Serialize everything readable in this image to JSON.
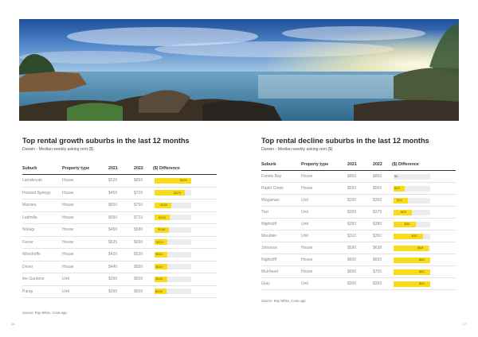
{
  "hero": {
    "alt_subject": "coastal sunset photo"
  },
  "left": {
    "title": "Top rental growth suburbs in the last 12 months",
    "subtitle": "Darwin - Median weekly asking rent ($)",
    "headers": [
      "Suburb",
      "Property type",
      "2021",
      "2022",
      "($) Difference"
    ],
    "rows": [
      {
        "suburb": "Larrakeyah",
        "type": "House",
        "y2021": "$525",
        "y2022": "$850",
        "diff": "$325",
        "diff_value": 325
      },
      {
        "suburb": "Howard Springs",
        "type": "House",
        "y2021": "$455",
        "y2022": "$725",
        "diff": "$270",
        "diff_value": 270
      },
      {
        "suburb": "Marrara",
        "type": "House",
        "y2021": "$600",
        "y2022": "$750",
        "diff": "$150",
        "diff_value": 150
      },
      {
        "suburb": "Ludmilla",
        "type": "House",
        "y2021": "$590",
        "y2022": "$723",
        "diff": "$133",
        "diff_value": 133
      },
      {
        "suburb": "Wulagi",
        "type": "House",
        "y2021": "$450",
        "y2022": "$580",
        "diff": "$130",
        "diff_value": 130
      },
      {
        "suburb": "Farrar",
        "type": "House",
        "y2021": "$535",
        "y2022": "$650",
        "diff": "$115",
        "diff_value": 115
      },
      {
        "suburb": "Woodroffe",
        "type": "House",
        "y2021": "$420",
        "y2022": "$530",
        "diff": "$110",
        "diff_value": 110
      },
      {
        "suburb": "Driver",
        "type": "House",
        "y2021": "$440",
        "y2022": "$550",
        "diff": "$110",
        "diff_value": 110
      },
      {
        "suburb": "the Gardens",
        "type": "Unit",
        "y2021": "$390",
        "y2022": "$500",
        "diff": "$110",
        "diff_value": 110
      },
      {
        "suburb": "Parap",
        "type": "Unit",
        "y2021": "$395",
        "y2022": "$500",
        "diff": "$105",
        "diff_value": 105
      }
    ],
    "bar_max": 325,
    "source": "Source: Ray White, CoreLogic"
  },
  "right": {
    "title": "Top rental decline suburbs in the last 12 months",
    "subtitle": "Darwin - Median weekly asking rent ($)",
    "headers": [
      "Suburb",
      "Property type",
      "2021",
      "2022",
      "($) Difference"
    ],
    "rows": [
      {
        "suburb": "Fannie Bay",
        "type": "House",
        "y2021": "$850",
        "y2022": "$850",
        "diff": "$0",
        "diff_value": 0
      },
      {
        "suburb": "Rapid Creek",
        "type": "House",
        "y2021": "$550",
        "y2022": "$565",
        "diff": "$15",
        "diff_value": 15
      },
      {
        "suburb": "Wagaman",
        "type": "Unit",
        "y2021": "$330",
        "y2022": "$350",
        "diff": "$20",
        "diff_value": 20
      },
      {
        "suburb": "Tiwi",
        "type": "Unit",
        "y2021": "$350",
        "y2022": "$375",
        "diff": "$25",
        "diff_value": 25
      },
      {
        "suburb": "Nightcliff",
        "type": "Unit",
        "y2021": "$350",
        "y2022": "$380",
        "diff": "$30",
        "diff_value": 30
      },
      {
        "suburb": "Moulden",
        "type": "Unit",
        "y2021": "$310",
        "y2022": "$350",
        "diff": "$40",
        "diff_value": 40
      },
      {
        "suburb": "Johnston",
        "type": "House",
        "y2021": "$590",
        "y2022": "$638",
        "diff": "$48",
        "diff_value": 48
      },
      {
        "suburb": "Nightcliff",
        "type": "House",
        "y2021": "$600",
        "y2022": "$650",
        "diff": "$50",
        "diff_value": 50
      },
      {
        "suburb": "Muirhead",
        "type": "House",
        "y2021": "$650",
        "y2022": "$700",
        "diff": "$50",
        "diff_value": 50
      },
      {
        "suburb": "Gray",
        "type": "Unit",
        "y2021": "$300",
        "y2022": "$350",
        "diff": "$50",
        "diff_value": 50
      }
    ],
    "bar_max": 50,
    "source": "Source: Ray White, CoreLogic"
  },
  "page_numbers": {
    "left": "16",
    "right": "17"
  },
  "colors": {
    "bar": "#f7dc1a",
    "track": "#ececec"
  }
}
